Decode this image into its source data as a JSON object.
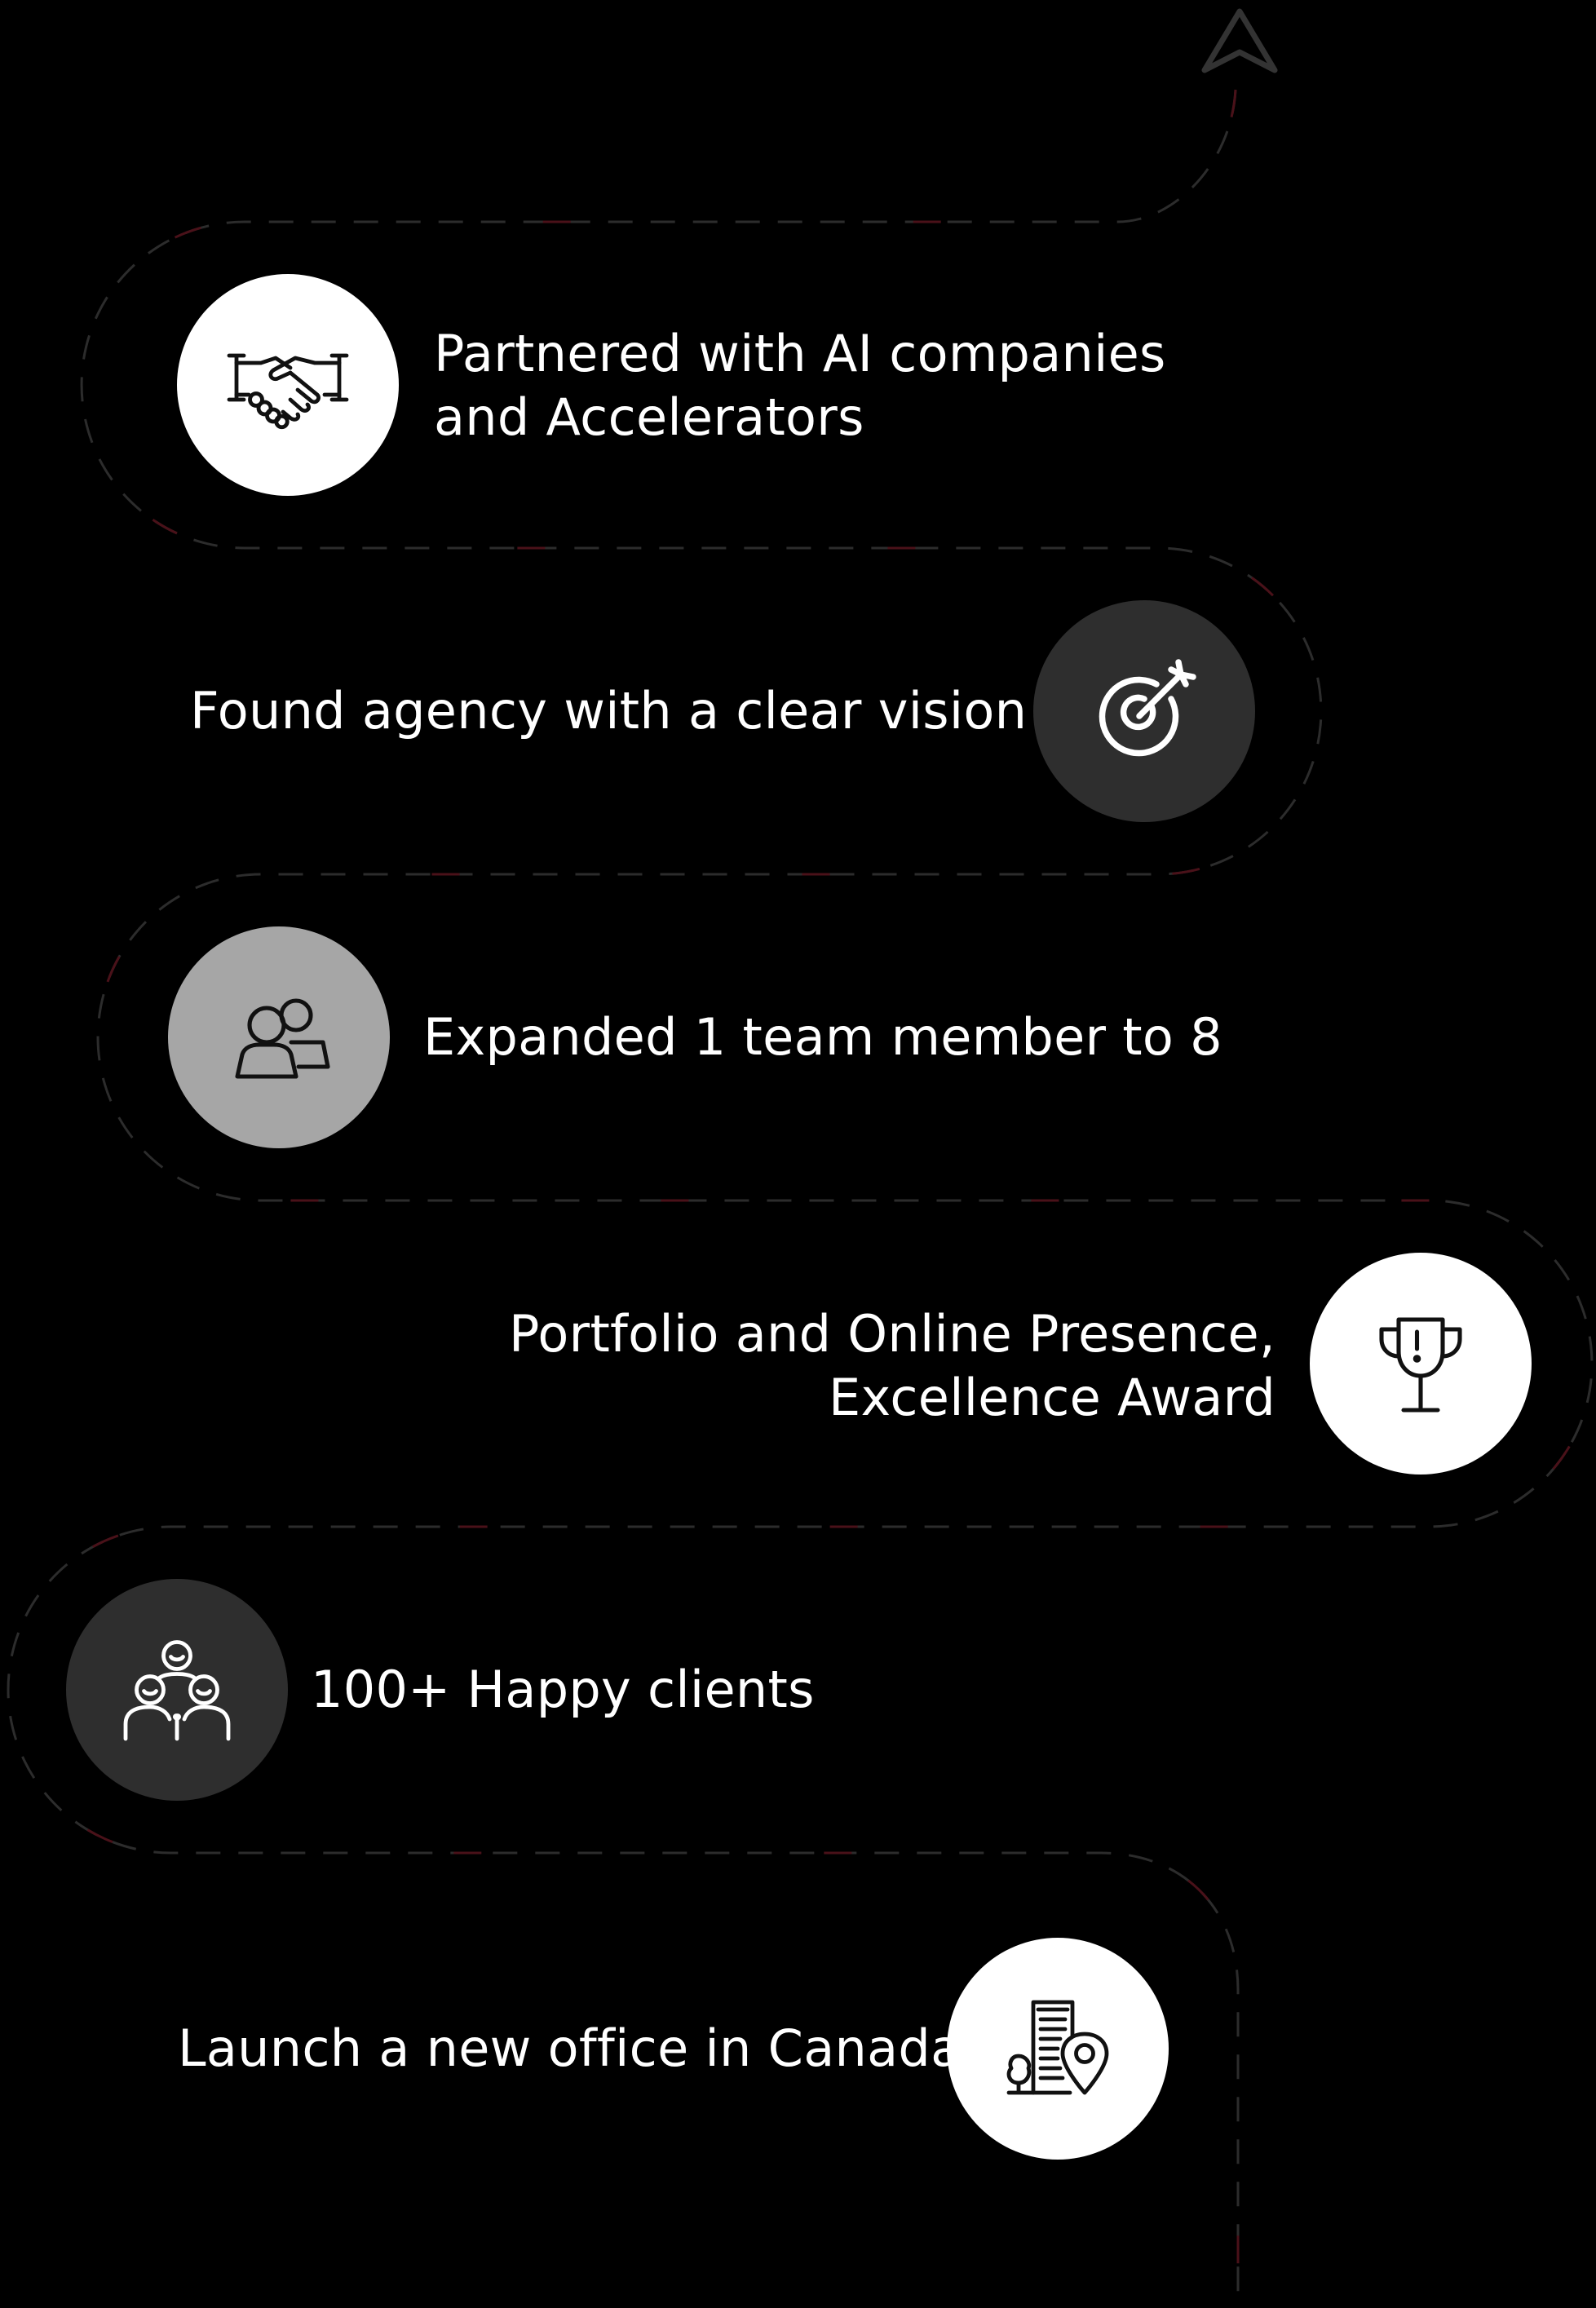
{
  "colors": {
    "background": "#000000",
    "text": "#ffffff",
    "path_dash": "#2c2c2c",
    "path_accent": "#4a1119",
    "arrow": "#333333"
  },
  "milestones": [
    {
      "lines": [
        "Partnered with AI companies",
        "and Accelerators"
      ],
      "icon": "handshake-icon",
      "circle_color": "#ffffff",
      "icon_color": "#111111"
    },
    {
      "lines": [
        "Found agency with a clear vision"
      ],
      "icon": "target-arrow-icon",
      "circle_color": "#2e2e2e",
      "icon_color": "#ffffff"
    },
    {
      "lines": [
        "Expanded 1 team member to 8"
      ],
      "icon": "team-members-icon",
      "circle_color": "#a6a6a6",
      "icon_color": "#111111"
    },
    {
      "lines": [
        "Portfolio and Online Presence,",
        "Excellence Award"
      ],
      "icon": "trophy-icon",
      "circle_color": "#ffffff",
      "icon_color": "#111111"
    },
    {
      "lines": [
        "100+ Happy clients"
      ],
      "icon": "happy-clients-icon",
      "circle_color": "#2e2e2e",
      "icon_color": "#ffffff"
    },
    {
      "lines": [
        "Launch a new office in Canada"
      ],
      "icon": "office-location-icon",
      "circle_color": "#ffffff",
      "icon_color": "#111111"
    }
  ]
}
